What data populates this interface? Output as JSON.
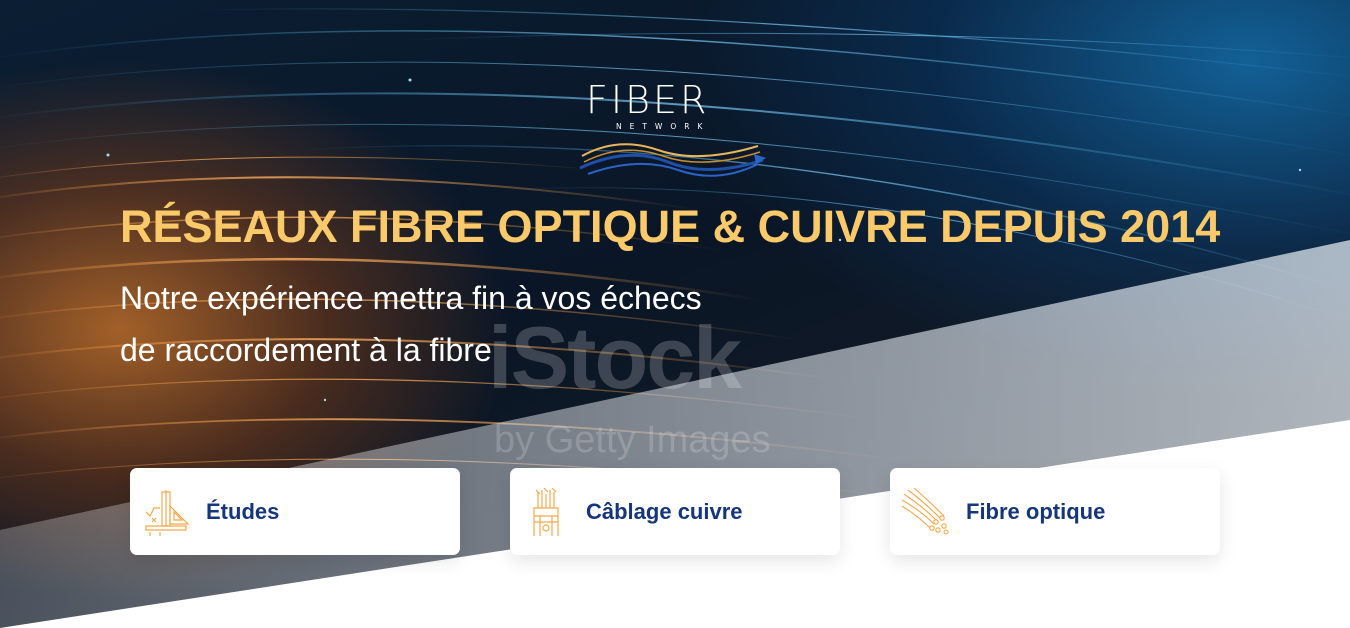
{
  "logo": {
    "word": "FIBER",
    "sub": "NETWORK"
  },
  "hero": {
    "headline": "RÉSEAUX FIBRE OPTIQUE & CUIVRE DEPUIS 2014",
    "subline_1": "Notre expérience mettra fin à vos échecs",
    "subline_2": "de raccordement à la fibre"
  },
  "watermark": {
    "main": "iStock",
    "sub": "by Getty Images"
  },
  "cards": [
    {
      "label": "Études",
      "icon": "drafting-tools-icon"
    },
    {
      "label": "Câblage cuivre",
      "icon": "copper-cable-icon"
    },
    {
      "label": "Fibre optique",
      "icon": "fiber-strands-icon"
    }
  ],
  "colors": {
    "headline": "#f9c96a",
    "card_text": "#15367a",
    "icon_orange": "#f2a94a"
  }
}
